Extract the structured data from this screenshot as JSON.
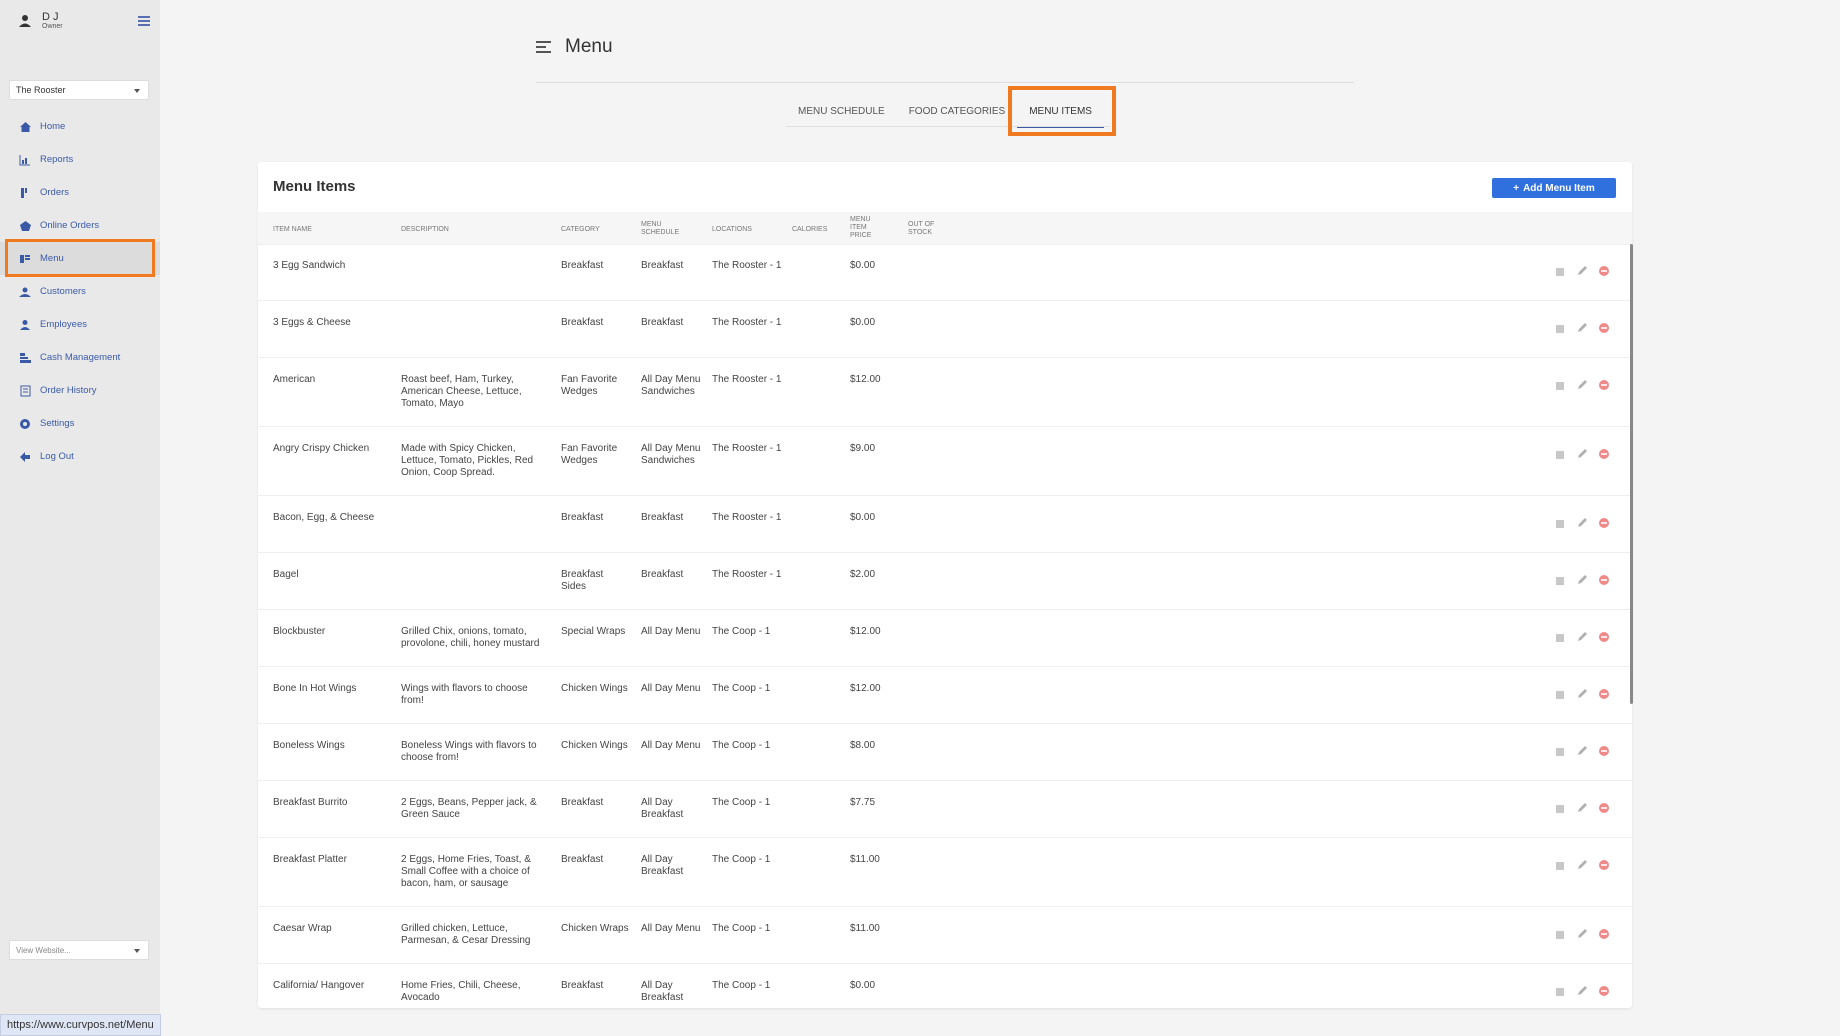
{
  "user": {
    "name": "D J",
    "role": "Owner"
  },
  "location_select": {
    "value": "The Rooster"
  },
  "nav": [
    {
      "label": "Home",
      "icon": "home-icon"
    },
    {
      "label": "Reports",
      "icon": "chart-icon"
    },
    {
      "label": "Orders",
      "icon": "orders-icon"
    },
    {
      "label": "Online Orders",
      "icon": "online-orders-icon"
    },
    {
      "label": "Menu",
      "icon": "menu-icon",
      "active": true
    },
    {
      "label": "Customers",
      "icon": "customers-icon"
    },
    {
      "label": "Employees",
      "icon": "employees-icon"
    },
    {
      "label": "Cash Management",
      "icon": "cash-icon"
    },
    {
      "label": "Order History",
      "icon": "history-icon"
    },
    {
      "label": "Settings",
      "icon": "gear-icon"
    },
    {
      "label": "Log Out",
      "icon": "logout-icon"
    }
  ],
  "view_website": {
    "placeholder": "View Website..."
  },
  "status_url": "https://www.curvpos.net/Menu",
  "header": {
    "title": "Menu"
  },
  "tabs": [
    {
      "label": "MENU SCHEDULE"
    },
    {
      "label": "FOOD CATEGORIES"
    },
    {
      "label": "MENU ITEMS",
      "active": true
    }
  ],
  "card": {
    "title": "Menu Items",
    "add_label": "Add Menu Item"
  },
  "columns": {
    "item_name": "ITEM NAME",
    "description": "DESCRIPTION",
    "category": "CATEGORY",
    "menu_schedule": "MENU SCHEDULE",
    "locations": "LOCATIONS",
    "calories": "CALORIES",
    "price": "MENU ITEM PRICE",
    "out_of_stock": "OUT OF STOCK"
  },
  "rows": [
    {
      "name": "3 Egg Sandwich",
      "description": "",
      "category": "Breakfast",
      "schedule": "Breakfast",
      "location": "The Rooster - 1",
      "price": "$0.00"
    },
    {
      "name": "3 Eggs & Cheese",
      "description": "",
      "category": "Breakfast",
      "schedule": "Breakfast",
      "location": "The Rooster - 1",
      "price": "$0.00"
    },
    {
      "name": "American",
      "description": "Roast beef, Ham, Turkey, American Cheese, Lettuce, Tomato, Mayo",
      "category": "Fan Favorite Wedges",
      "schedule": "All Day Menu Sandwiches",
      "location": "The Rooster - 1",
      "price": "$12.00"
    },
    {
      "name": "Angry Crispy Chicken",
      "description": "Made with Spicy Chicken, Lettuce, Tomato, Pickles, Red Onion, Coop Spread.",
      "category": "Fan Favorite Wedges",
      "schedule": "All Day Menu Sandwiches",
      "location": "The Rooster - 1",
      "price": "$9.00"
    },
    {
      "name": "Bacon, Egg, & Cheese",
      "description": "",
      "category": "Breakfast",
      "schedule": "Breakfast",
      "location": "The Rooster - 1",
      "price": "$0.00"
    },
    {
      "name": "Bagel",
      "description": "",
      "category": "Breakfast Sides",
      "schedule": "Breakfast",
      "location": "The Rooster - 1",
      "price": "$2.00"
    },
    {
      "name": "Blockbuster",
      "description": "Grilled Chix, onions, tomato, provolone, chili, honey mustard",
      "category": "Special Wraps",
      "schedule": "All Day Menu",
      "location": "The Coop - 1",
      "price": "$12.00"
    },
    {
      "name": "Bone In Hot Wings",
      "description": "Wings with flavors to choose from!",
      "category": "Chicken Wings",
      "schedule": "All Day Menu",
      "location": "The Coop - 1",
      "price": "$12.00"
    },
    {
      "name": "Boneless Wings",
      "description": "Boneless Wings with flavors to choose from!",
      "category": "Chicken Wings",
      "schedule": "All Day Menu",
      "location": "The Coop - 1",
      "price": "$8.00"
    },
    {
      "name": "Breakfast Burrito",
      "description": "2 Eggs, Beans, Pepper jack, & Green Sauce",
      "category": "Breakfast",
      "schedule": "All Day Breakfast",
      "location": "The Coop - 1",
      "price": "$7.75"
    },
    {
      "name": "Breakfast Platter",
      "description": "2 Eggs, Home Fries, Toast, & Small Coffee with a choice of bacon, ham, or sausage",
      "category": "Breakfast",
      "schedule": "All Day Breakfast",
      "location": "The Coop - 1",
      "price": "$11.00"
    },
    {
      "name": "Caesar Wrap",
      "description": "Grilled chicken, Lettuce, Parmesan, & Cesar Dressing",
      "category": "Chicken Wraps",
      "schedule": "All Day Menu",
      "location": "The Coop - 1",
      "price": "$11.00"
    },
    {
      "name": "California/ Hangover",
      "description": "Home Fries, Chili, Cheese, Avocado",
      "category": "Breakfast",
      "schedule": "All Day Breakfast",
      "location": "The Coop - 1",
      "price": "$0.00"
    }
  ]
}
